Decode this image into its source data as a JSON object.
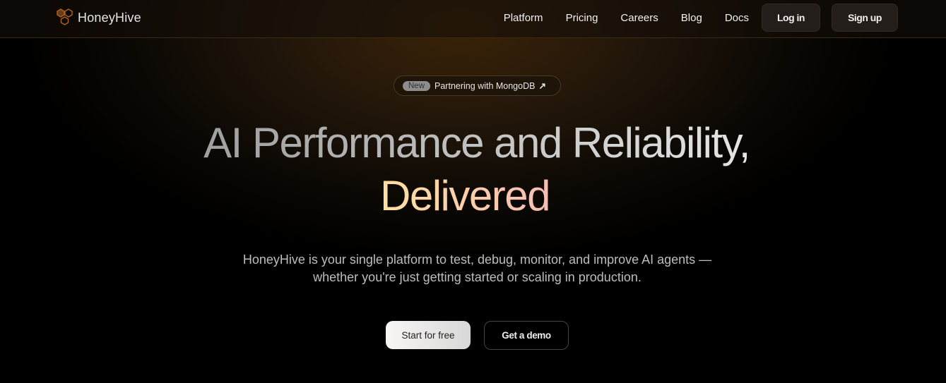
{
  "brand": {
    "name": "HoneyHive",
    "accent": "#c77a2a"
  },
  "nav": {
    "links": [
      "Platform",
      "Pricing",
      "Careers",
      "Blog",
      "Docs"
    ],
    "login": "Log in",
    "signup": "Sign up"
  },
  "announcement": {
    "tag": "New",
    "text": "Partnering with MongoDB",
    "icon": "arrow-up-right-icon"
  },
  "hero": {
    "title_line1": "AI Performance and Reliability,",
    "title_line2": "Delivered",
    "subtitle_line1": "HoneyHive is your single platform to test, debug, monitor, and improve AI agents —",
    "subtitle_line2": "whether you're just getting started or scaling in production.",
    "primary_cta": "Start for free",
    "secondary_cta": "Get a demo"
  }
}
